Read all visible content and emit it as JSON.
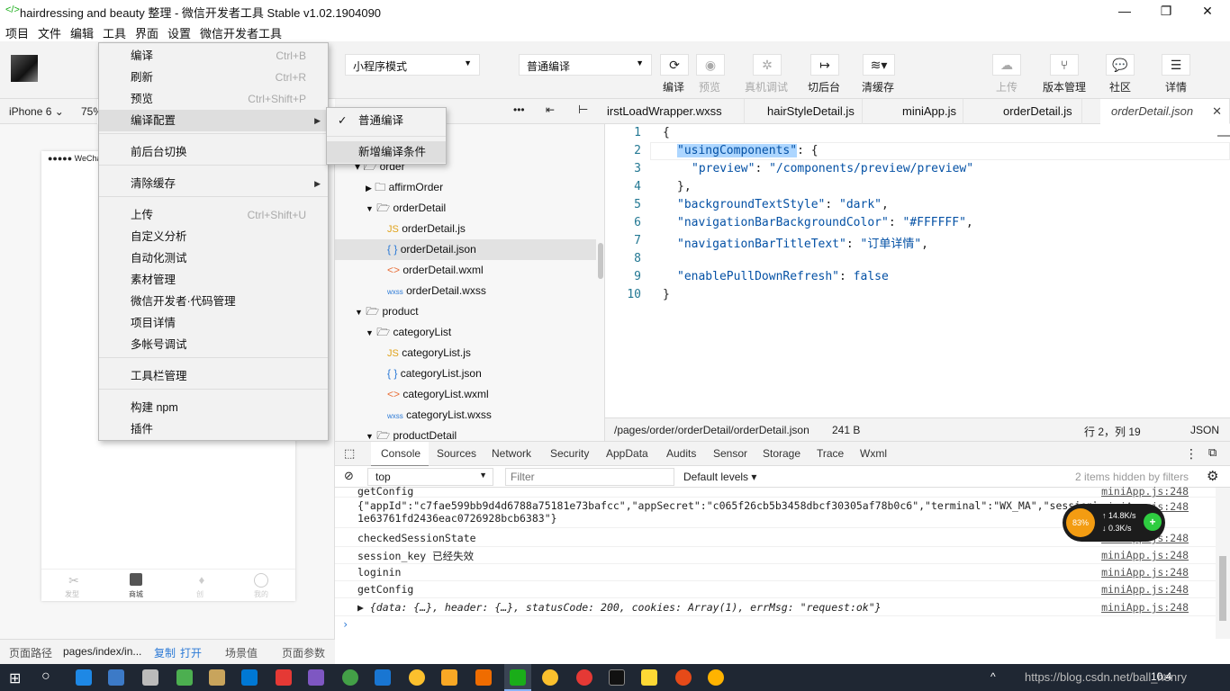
{
  "window": {
    "title": "hairdressing and beauty 整理 - 微信开发者工具 Stable v1.02.1904090"
  },
  "menubar": [
    "项目",
    "文件",
    "编辑",
    "工具",
    "界面",
    "设置",
    "微信开发者工具"
  ],
  "toolbar": {
    "mode_select": "小程序模式",
    "compile_select": "普通编译",
    "buttons": [
      {
        "label": "编译",
        "icon": "refresh-icon"
      },
      {
        "label": "预览",
        "icon": "eye-icon"
      },
      {
        "label": "真机调试",
        "icon": "bug-icon"
      },
      {
        "label": "切后台",
        "icon": "switch-icon"
      },
      {
        "label": "清缓存",
        "icon": "layers-icon"
      },
      {
        "label": "上传",
        "icon": "cloud-upload-icon"
      },
      {
        "label": "版本管理",
        "icon": "branch-icon"
      },
      {
        "label": "社区",
        "icon": "chat-icon"
      },
      {
        "label": "详情",
        "icon": "menu-icon"
      }
    ]
  },
  "simulator": {
    "device": "iPhone 6",
    "zoom": "75%",
    "carrier": "●●●●● WeCha",
    "tabbar": [
      "发型",
      "商城",
      "创",
      "我的"
    ]
  },
  "tools_menu": {
    "items": [
      {
        "label": "编译",
        "shortcut": "Ctrl+B",
        "disabled": false
      },
      {
        "label": "刷新",
        "shortcut": "Ctrl+R",
        "disabled": false
      },
      {
        "label": "预览",
        "shortcut": "Ctrl+Shift+P",
        "disabled": true
      },
      {
        "label": "编译配置",
        "shortcut": "",
        "disabled": false
      },
      {
        "label": "前后台切换",
        "shortcut": "",
        "disabled": false
      },
      {
        "label": "清除缓存",
        "shortcut": "",
        "disabled": false
      },
      {
        "label": "上传",
        "shortcut": "Ctrl+Shift+U",
        "disabled": true
      },
      {
        "label": "自定义分析",
        "shortcut": "",
        "disabled": true
      },
      {
        "label": "自动化测试",
        "shortcut": "",
        "disabled": true
      },
      {
        "label": "素材管理",
        "shortcut": "",
        "disabled": true
      },
      {
        "label": "微信开发者·代码管理",
        "shortcut": "",
        "disabled": true
      },
      {
        "label": "项目详情",
        "shortcut": "",
        "disabled": false
      },
      {
        "label": "多帐号调试",
        "shortcut": "",
        "disabled": true
      },
      {
        "label": "工具栏管理",
        "shortcut": "",
        "disabled": false
      },
      {
        "label": "构建 npm",
        "shortcut": "",
        "disabled": false
      },
      {
        "label": "插件",
        "shortcut": "",
        "disabled": false
      }
    ]
  },
  "compile_submenu": {
    "items": [
      "普通编译",
      "新增编译条件"
    ]
  },
  "file_tree": {
    "rows": [
      "order",
      "affirmOrder",
      "orderDetail",
      "orderDetail.js",
      "orderDetail.json",
      "orderDetail.wxml",
      "orderDetail.wxss",
      "product",
      "categoryList",
      "categoryList.js",
      "categoryList.json",
      "categoryList.wxml",
      "categoryList.wxss",
      "productDetail"
    ]
  },
  "editor_tabs": [
    "irstLoadWrapper.wxss",
    "hairStyleDetail.js",
    "miniApp.js",
    "orderDetail.js",
    "orderDetail.json"
  ],
  "code": {
    "line_numbers": [
      "1",
      "2",
      "3",
      "4",
      "5",
      "6",
      "7",
      "8",
      "9",
      "10"
    ],
    "key1": "\"usingComponents\"",
    "key2": "\"preview\"",
    "val2": "\"/components/preview/preview\"",
    "key5": "\"backgroundTextStyle\"",
    "val5": "\"dark\"",
    "key6": "\"navigationBarBackgroundColor\"",
    "val6": "\"#FFFFFF\"",
    "key7": "\"navigationBarTitleText\"",
    "val7": "\"订单详情\"",
    "key9": "\"enablePullDownRefresh\"",
    "val9": "false"
  },
  "statusbar": {
    "path": "/pages/order/orderDetail/orderDetail.json",
    "size": "241 B",
    "position": "行 2，列 19",
    "lang": "JSON"
  },
  "devtools": {
    "tabs": [
      "Console",
      "Sources",
      "Network",
      "Security",
      "AppData",
      "Audits",
      "Sensor",
      "Storage",
      "Trace",
      "Wxml"
    ],
    "context": "top",
    "filter_placeholder": "Filter",
    "levels": "Default levels",
    "hidden": "2 items hidden by filters"
  },
  "console": {
    "rows": [
      {
        "text": "getConfig",
        "src": "miniApp.js:248"
      },
      {
        "text": "{\"appId\":\"c7fae599bb9d4d6788a75181e73bafcc\",\"appSecret\":\"c065f26cb5b3458dbcf30305af78b0c6\",\"terminal\":\"WX_MA\",\"sessionId\":\"62...",
        "src": "miniApp.js:248",
        "text2": "1e63761fd2436eac0726928bcb6383\"}"
      },
      {
        "text": "checkedSessionState",
        "src": "miniApp.js:248"
      },
      {
        "text": "session_key 已经失效",
        "src": "miniApp.js:248"
      },
      {
        "text": "loginin",
        "src": "miniApp.js:248"
      },
      {
        "text": "getConfig",
        "src": "miniApp.js:248"
      },
      {
        "text": "▶ {data: {…}, header: {…}, statusCode: 200, cookies: Array(1), errMsg: \"request:ok\"}",
        "src": "miniApp.js:248"
      }
    ]
  },
  "bottom": {
    "label": "页面路径",
    "path": "pages/index/in...",
    "copy": "复制",
    "open": "打开",
    "scene": "场景值",
    "params": "页面参数"
  },
  "network_widget": {
    "percent": "83%",
    "up": "14.8K/s",
    "down": "0.3K/s"
  },
  "taskbar": {
    "watermark": "https://blog.csdn.net/ball_henry",
    "time": "10:4"
  }
}
